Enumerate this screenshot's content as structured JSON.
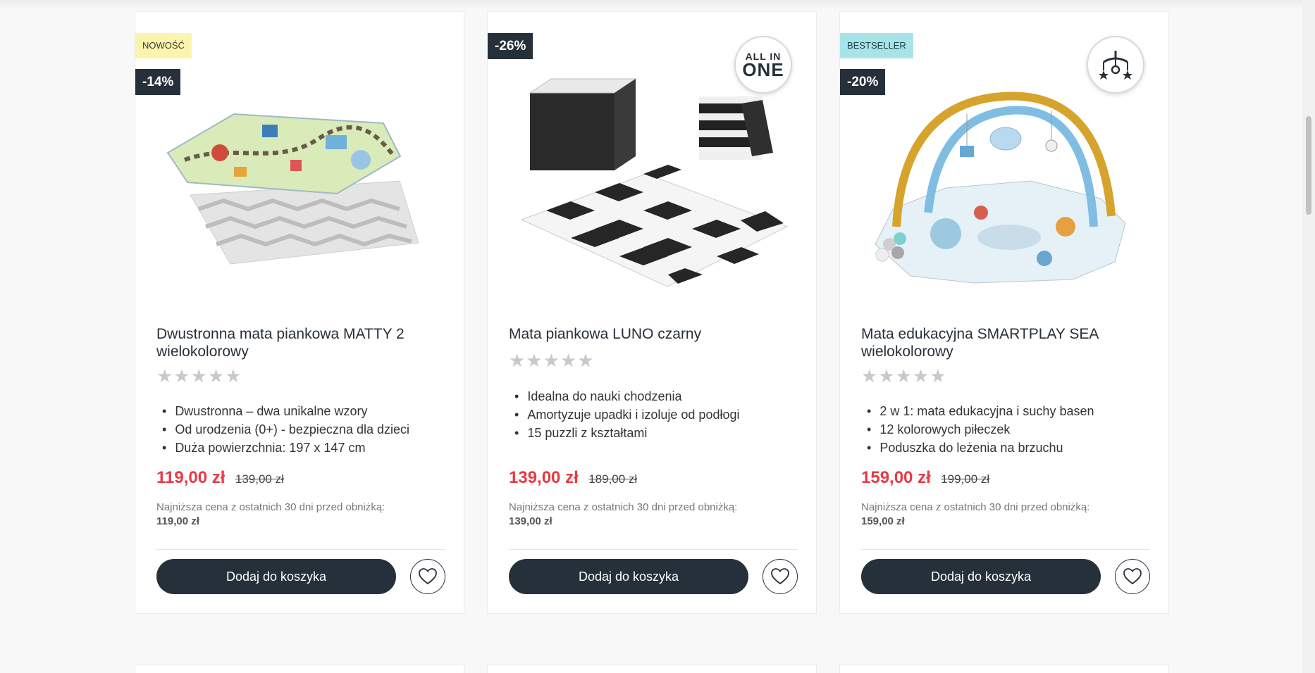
{
  "cards": [
    {
      "badges": [
        "NOWOŚĆ",
        "-14%"
      ],
      "title": "Dwustronna mata piankowa MATTY 2 wielokolorowy",
      "stars": "★★★★★",
      "features": [
        "Dwustronna – dwa unikalne wzory",
        "Od urodzenia (0+) - bezpieczna dla dzieci",
        "Duża powierzchnia: 197 x 147 cm"
      ],
      "price": "119,00 zł",
      "old_price": "139,00 zł",
      "lowest_label": "Najniższa cena z ostatnich 30 dni przed obniżką:",
      "lowest_value": "119,00 zł",
      "add_label": "Dodaj do koszyka"
    },
    {
      "badges": [
        "-26%"
      ],
      "round_badge": {
        "line1": "ALL IN",
        "line2": "ONE"
      },
      "title": "Mata piankowa LUNO czarny",
      "stars": "★★★★★",
      "features": [
        "Idealna do nauki chodzenia",
        "Amortyzuje upadki i izoluje od podłogi",
        "15 puzzli z kształtami"
      ],
      "price": "139,00 zł",
      "old_price": "189,00 zł",
      "lowest_label": "Najniższa cena z ostatnich 30 dni przed obniżką:",
      "lowest_value": "139,00 zł",
      "add_label": "Dodaj do koszyka"
    },
    {
      "badges": [
        "BESTSELLER",
        "-20%"
      ],
      "round_badge_icon": "mobile-toy-icon",
      "title": "Mata edukacyjna SMARTPLAY SEA wielokolorowy",
      "stars": "★★★★★",
      "features": [
        "2 w 1: mata edukacyjna i suchy basen",
        "12 kolorowych piłeczek",
        "Poduszka do leżenia na brzuchu"
      ],
      "price": "159,00 zł",
      "old_price": "199,00 zł",
      "lowest_label": "Najniższa cena z ostatnich 30 dni przed obniżką:",
      "lowest_value": "159,00 zł",
      "add_label": "Dodaj do koszyka"
    }
  ],
  "colors": {
    "dark": "#26303a",
    "price": "#e83a44",
    "badge_new": "#fbf4ad",
    "badge_best": "#a6e4e8"
  }
}
